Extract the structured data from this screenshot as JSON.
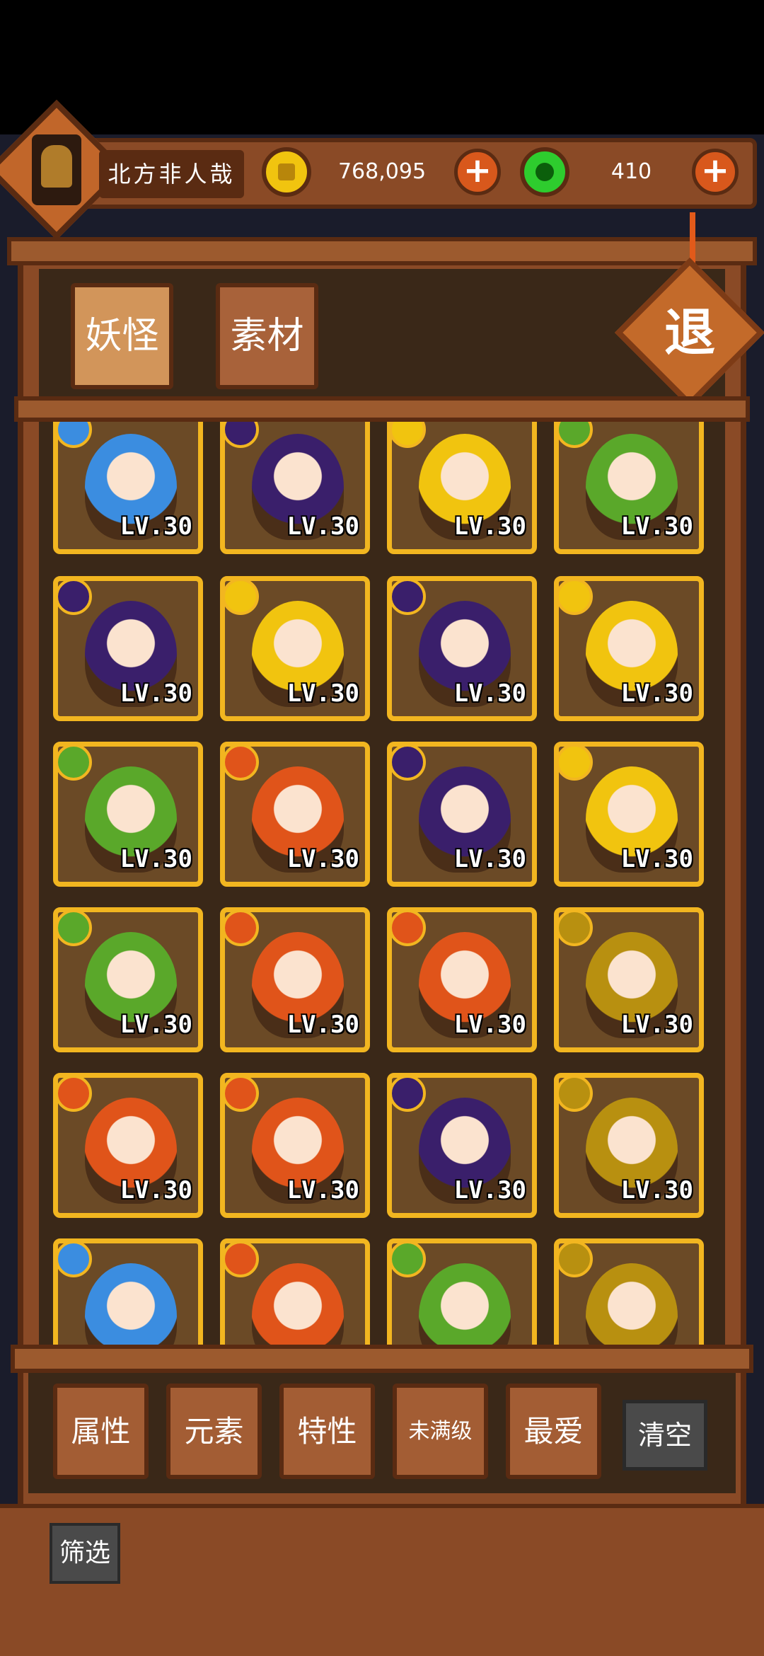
{
  "header": {
    "player_name": "北方非人哉",
    "gold_amount": "768,095",
    "jade_amount": "410",
    "plus_symbol": "+"
  },
  "tabs": {
    "yokai": "妖怪",
    "material": "素材"
  },
  "exit_label": "退",
  "cards": [
    {
      "element": "water",
      "color": "#3b8de0",
      "lv": "LV.30"
    },
    {
      "element": "moon",
      "color": "#3a1f6b",
      "lv": "LV.30"
    },
    {
      "element": "sun",
      "color": "#f1c40f",
      "lv": "LV.30"
    },
    {
      "element": "leaf",
      "color": "#5aa82a",
      "lv": "LV.30"
    },
    {
      "element": "moon",
      "color": "#3a1f6b",
      "lv": "LV.30"
    },
    {
      "element": "sun",
      "color": "#f1c40f",
      "lv": "LV.30"
    },
    {
      "element": "moon",
      "color": "#3a1f6b",
      "lv": "LV.30"
    },
    {
      "element": "sun",
      "color": "#f1c40f",
      "lv": "LV.30"
    },
    {
      "element": "leaf",
      "color": "#5aa82a",
      "lv": "LV.30"
    },
    {
      "element": "fire",
      "color": "#e0541a",
      "lv": "LV.30"
    },
    {
      "element": "moon",
      "color": "#3a1f6b",
      "lv": "LV.30"
    },
    {
      "element": "sun",
      "color": "#f1c40f",
      "lv": "LV.30"
    },
    {
      "element": "leaf",
      "color": "#5aa82a",
      "lv": "LV.30"
    },
    {
      "element": "fire",
      "color": "#e0541a",
      "lv": "LV.30"
    },
    {
      "element": "fire",
      "color": "#e0541a",
      "lv": "LV.30"
    },
    {
      "element": "earth",
      "color": "#b89010",
      "lv": "LV.30"
    },
    {
      "element": "fire",
      "color": "#e0541a",
      "lv": "LV.30"
    },
    {
      "element": "fire",
      "color": "#e0541a",
      "lv": "LV.30"
    },
    {
      "element": "moon",
      "color": "#3a1f6b",
      "lv": "LV.30"
    },
    {
      "element": "earth",
      "color": "#b89010",
      "lv": "LV.30"
    },
    {
      "element": "water",
      "color": "#3b8de0",
      "lv": ""
    },
    {
      "element": "fire",
      "color": "#e0541a",
      "lv": ""
    },
    {
      "element": "leaf",
      "color": "#5aa82a",
      "lv": ""
    },
    {
      "element": "earth",
      "color": "#b89010",
      "lv": ""
    }
  ],
  "filters": {
    "attribute": "属性",
    "element": "元素",
    "trait": "特性",
    "not_max_level": "未满级",
    "favorite": "最爱",
    "clear": "清空",
    "filter": "筛选"
  },
  "colors": {
    "wood": "#8a4a26",
    "wood_dark": "#5a2b12",
    "card_border": "#f2b620"
  }
}
